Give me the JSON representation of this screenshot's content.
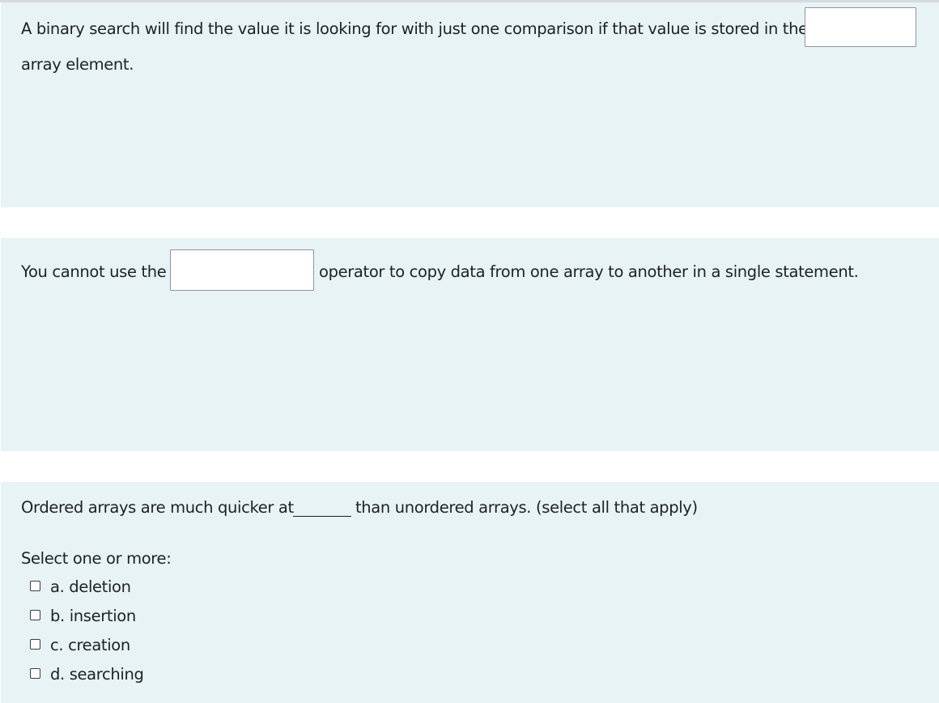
{
  "questions": [
    {
      "text_before": "A binary search will find the value it is looking for with just one comparison if that value is stored in the",
      "answer_value": "",
      "text_after": "array element."
    },
    {
      "text_before": "You cannot use the",
      "answer_value": "",
      "text_after": "operator to copy data from one array to another in a single statement."
    },
    {
      "text_before": "Ordered arrays are much quicker at",
      "text_after": "than unordered arrays. (select all that apply)",
      "prompt": "Select one or more:",
      "options": [
        {
          "label": "a. deletion",
          "checked": false
        },
        {
          "label": "b. insertion",
          "checked": false
        },
        {
          "label": "c. creation",
          "checked": false
        },
        {
          "label": "d. searching",
          "checked": false
        }
      ]
    }
  ],
  "colors": {
    "question_background": "#e7f3f5",
    "input_border": "#8f959e",
    "text": "#1d2125"
  }
}
